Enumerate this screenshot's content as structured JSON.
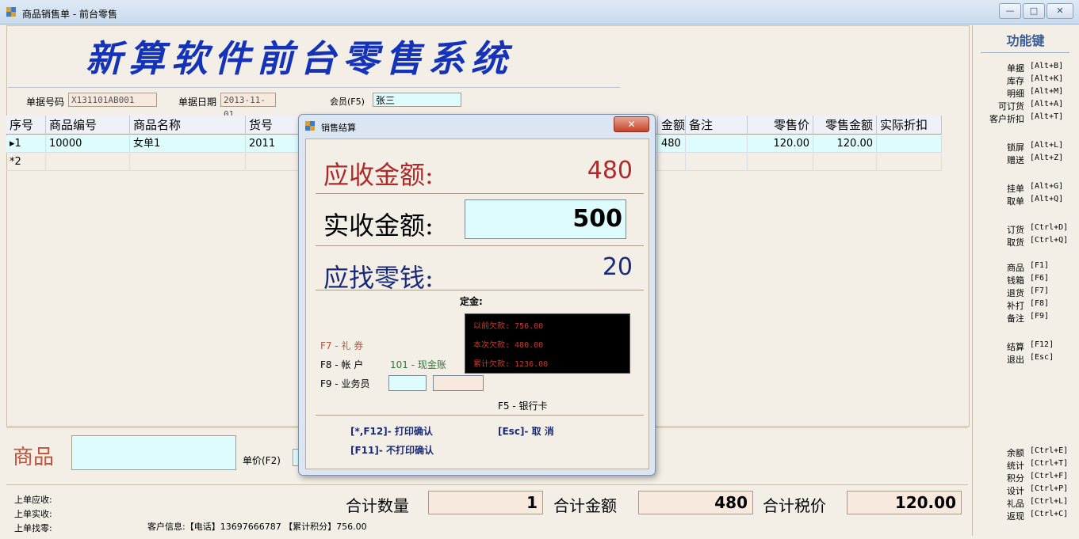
{
  "window": {
    "title": "商品销售单 - 前台零售",
    "min": "—",
    "max": "□",
    "close": "✕"
  },
  "banner": "新算软件前台零售系统",
  "header": {
    "doc_no_label": "单据号码",
    "doc_no": "X131101AB001",
    "doc_date_label": "单据日期",
    "doc_date": "2013-11-01",
    "member_label": "会员(F5)",
    "member": "张三"
  },
  "grid": {
    "columns": [
      "序号",
      "商品编号",
      "商品名称",
      "货号",
      "金额",
      "备注",
      "零售价",
      "零售金额",
      "实际折扣"
    ],
    "rows": [
      {
        "seq": "▸1",
        "code": "10000",
        "name": "女单1",
        "sku": "2011",
        "amount": "480",
        "note": "",
        "price": "120.00",
        "retail_amount": "120.00",
        "discount": ""
      },
      {
        "seq": "*2",
        "code": "",
        "name": "",
        "sku": "",
        "amount": "",
        "note": "",
        "price": "",
        "retail_amount": "",
        "discount": ""
      }
    ]
  },
  "function_keys": {
    "title": "功能键",
    "groups": [
      [
        {
          "n": "单据",
          "k": "[Alt+B]"
        },
        {
          "n": "库存",
          "k": "[Alt+K]"
        },
        {
          "n": "明细",
          "k": "[Alt+M]"
        },
        {
          "n": "可订货",
          "k": "[Alt+A]"
        },
        {
          "n": "客户折扣",
          "k": "[Alt+T]"
        }
      ],
      [
        {
          "n": "锁屏",
          "k": "[Alt+L]"
        },
        {
          "n": "赠送",
          "k": "[Alt+Z]"
        }
      ],
      [
        {
          "n": "挂单",
          "k": "[Alt+G]"
        },
        {
          "n": "取单",
          "k": "[Alt+Q]"
        }
      ],
      [
        {
          "n": "订货",
          "k": "[Ctrl+D]"
        },
        {
          "n": "取货",
          "k": "[Ctrl+Q]"
        }
      ],
      [
        {
          "n": "商品",
          "k": "[F1]"
        },
        {
          "n": "钱箱",
          "k": "[F6]"
        },
        {
          "n": "退货",
          "k": "[F7]"
        },
        {
          "n": "补打",
          "k": "[F8]"
        },
        {
          "n": "备注",
          "k": "[F9]"
        }
      ],
      [
        {
          "n": "结算",
          "k": "[F12]"
        },
        {
          "n": "退出",
          "k": "[Esc]"
        }
      ],
      [
        {
          "n": "余额",
          "k": "[Ctrl+E]"
        },
        {
          "n": "统计",
          "k": "[Ctrl+T]"
        },
        {
          "n": "积分",
          "k": "[Ctrl+F]"
        },
        {
          "n": "设计",
          "k": "[Ctrl+P]"
        },
        {
          "n": "礼品",
          "k": "[Ctrl+L]"
        },
        {
          "n": "返现",
          "k": "[Ctrl+C]"
        }
      ]
    ]
  },
  "entry": {
    "product_label": "商品",
    "price_label": "单价(F2)"
  },
  "footer": {
    "prev_due": "上单应收:",
    "prev_paid": "上单实收:",
    "prev_change": "上单找零:",
    "cust_info": "客户信息:【电话】13697666787  【累计积分】756.00",
    "qty_label": "合计数量",
    "qty": "1",
    "amt_label": "合计金额",
    "amt": "480",
    "tax_label": "合计税价",
    "tax": "120.00"
  },
  "dialog": {
    "title": "销售结算",
    "due_label": "应收金额:",
    "due": "480",
    "paid_label": "实收金额:",
    "paid": "500",
    "change_label": "应找零钱:",
    "change": "20",
    "deposit_label": "定金:",
    "deposit_lines": [
      "以前欠款: 756.00",
      "本次欠款: 480.00",
      "累计欠款: 1236.00"
    ],
    "f7": "F7 - 礼  券",
    "f8_label": "F8 - 帐  户",
    "f8_value": "101 - 现金账",
    "f9_label": "F9 - 业务员",
    "f5": "F5 - 银行卡",
    "print_confirm": "[*,F12]- 打印确认",
    "no_print_confirm": "[F11]- 不打印确认",
    "cancel": "[Esc]- 取  消"
  },
  "colors": {
    "due": "#b02a2a",
    "paid": "#000000",
    "change": "#1a2b7a",
    "banner": "#1533b8"
  }
}
